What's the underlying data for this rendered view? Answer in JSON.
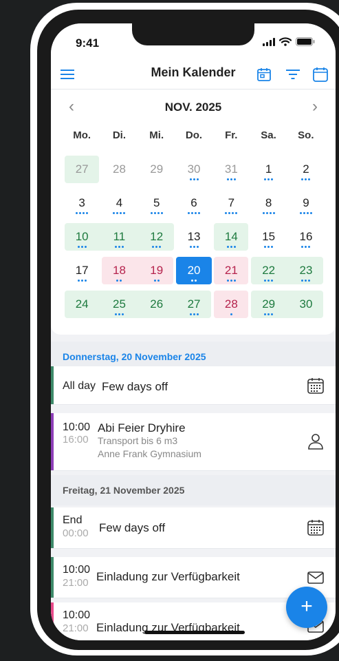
{
  "status": {
    "time": "9:41"
  },
  "header": {
    "title": "Mein Kalender",
    "menu_icon": "hamburger-icon",
    "today_icon": "calendar-today-icon",
    "filter_icon": "filter-icon",
    "view_icon": "calendar-view-icon"
  },
  "calendar": {
    "month": "NOV. 2025",
    "weekdays": [
      "Mo.",
      "Di.",
      "Mi.",
      "Do.",
      "Fr.",
      "Sa.",
      "So."
    ],
    "weeks": [
      [
        "27",
        "28",
        "29",
        "30",
        "31",
        "1",
        "2"
      ],
      [
        "3",
        "4",
        "5",
        "6",
        "7",
        "8",
        "9"
      ],
      [
        "10",
        "11",
        "12",
        "13",
        "14",
        "15",
        "16"
      ],
      [
        "17",
        "18",
        "19",
        "20",
        "21",
        "22",
        "23"
      ],
      [
        "24",
        "25",
        "26",
        "27",
        "28",
        "29",
        "30"
      ]
    ],
    "selected": "20"
  },
  "sections": [
    {
      "title": "Donnerstag, 20 November 2025"
    },
    {
      "title": "Freitag, 21 November 2025"
    }
  ],
  "events": [
    {
      "time": "All day",
      "end": "",
      "title": "Few days off",
      "sub1": "",
      "sub2": "",
      "icon": "calendar-grid-icon",
      "color": "#3e8a6a"
    },
    {
      "time": "10:00",
      "end": "16:00",
      "title": "Abi Feier Dryhire",
      "sub1": "Transport bis 6 m3",
      "sub2": "Anne Frank Gymnasium",
      "icon": "person-icon",
      "color": "#8e3fb8"
    },
    {
      "time": "End",
      "end": "00:00",
      "title": "Few days off",
      "sub1": "",
      "sub2": "",
      "icon": "calendar-grid-icon",
      "color": "#3e8a6a"
    },
    {
      "time": "10:00",
      "end": "21:00",
      "title": "Einladung zur Verfügbarkeit",
      "sub1": "",
      "sub2": "",
      "icon": "mail-icon",
      "color": "#3e8a6a"
    },
    {
      "time": "10:00",
      "end": "21:00",
      "title": "Einladung zur Verfügbarkeit",
      "sub1": "",
      "sub2": "",
      "icon": "mail-icon",
      "color": "#e84a8a"
    }
  ],
  "fab": {
    "label": "+"
  },
  "colors": {
    "accent": "#1a84e8",
    "green_bg": "#e4f4e9",
    "pink_bg": "#fbe5ea",
    "section_blue": "#1a84e8",
    "section_grey": "#555555"
  }
}
